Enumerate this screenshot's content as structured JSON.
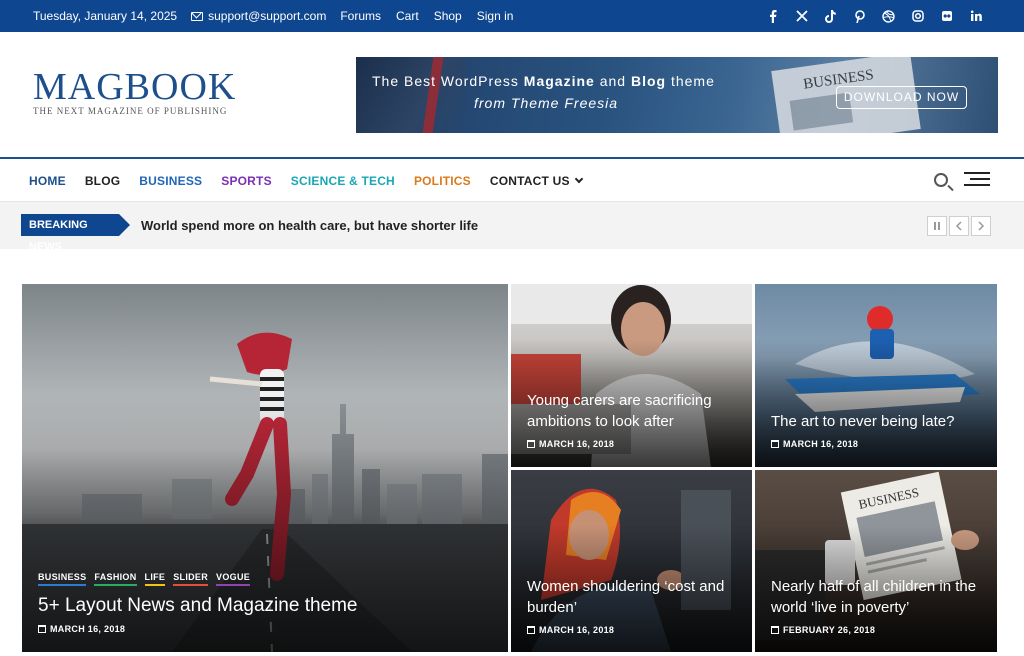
{
  "topbar": {
    "date": "Tuesday, January 14, 2025",
    "email": "support@support.com",
    "links": [
      "Forums",
      "Cart",
      "Shop",
      "Sign in"
    ],
    "socials": [
      "facebook-icon",
      "x-icon",
      "tiktok-icon",
      "pinterest-icon",
      "dribbble-icon",
      "instagram-icon",
      "flickr-icon",
      "linkedin-icon"
    ]
  },
  "header": {
    "logo_title": "MAGBOOK",
    "logo_tagline": "THE NEXT MAGAZINE OF PUBLISHING",
    "banner": {
      "line1_prefix": "The Best WordPress ",
      "line1_bold1": "Magazine",
      "line1_mid": " and ",
      "line1_bold2": "Blog",
      "line1_suffix": " theme",
      "line2": "from Theme Freesia",
      "newspaper_word": "BUSINESS",
      "cta": "DOWNLOAD NOW"
    }
  },
  "nav": {
    "items": [
      {
        "label": "HOME",
        "color": "#1d4f8c"
      },
      {
        "label": "BLOG",
        "color": "#222222"
      },
      {
        "label": "BUSINESS",
        "color": "#1f66b8"
      },
      {
        "label": "SPORTS",
        "color": "#7b2fb3"
      },
      {
        "label": "SCIENCE & TECH",
        "color": "#1aa6b7"
      },
      {
        "label": "POLITICS",
        "color": "#d97a1c"
      },
      {
        "label": "CONTACT US",
        "color": "#222222"
      }
    ]
  },
  "breaking": {
    "label": "BREAKING NEWS",
    "headline": "World spend more on health care, but have shorter life"
  },
  "posts": [
    {
      "title": "5+ Layout News and Magazine theme",
      "date": "MARCH 16, 2018",
      "categories": [
        {
          "name": "BUSINESS",
          "color": "#2f7bd4"
        },
        {
          "name": "FASHION",
          "color": "#27ae60"
        },
        {
          "name": "LIFE",
          "color": "#f1c40f"
        },
        {
          "name": "SLIDER",
          "color": "#e74c3c"
        },
        {
          "name": "VOGUE",
          "color": "#8e44ad"
        }
      ]
    },
    {
      "title": "Young carers are sacrificing ambitions to look after",
      "date": "MARCH 16, 2018"
    },
    {
      "title": "The art to never being late?",
      "date": "MARCH 16, 2018"
    },
    {
      "title": "Women shouldering ‘cost and burden’",
      "date": "MARCH 16, 2018"
    },
    {
      "title": "Nearly half of all children in the world ‘live in poverty’",
      "date": "FEBRUARY 26, 2018"
    }
  ],
  "colors": {
    "brand": "#0f4690",
    "logo": "#1d4f8c"
  }
}
